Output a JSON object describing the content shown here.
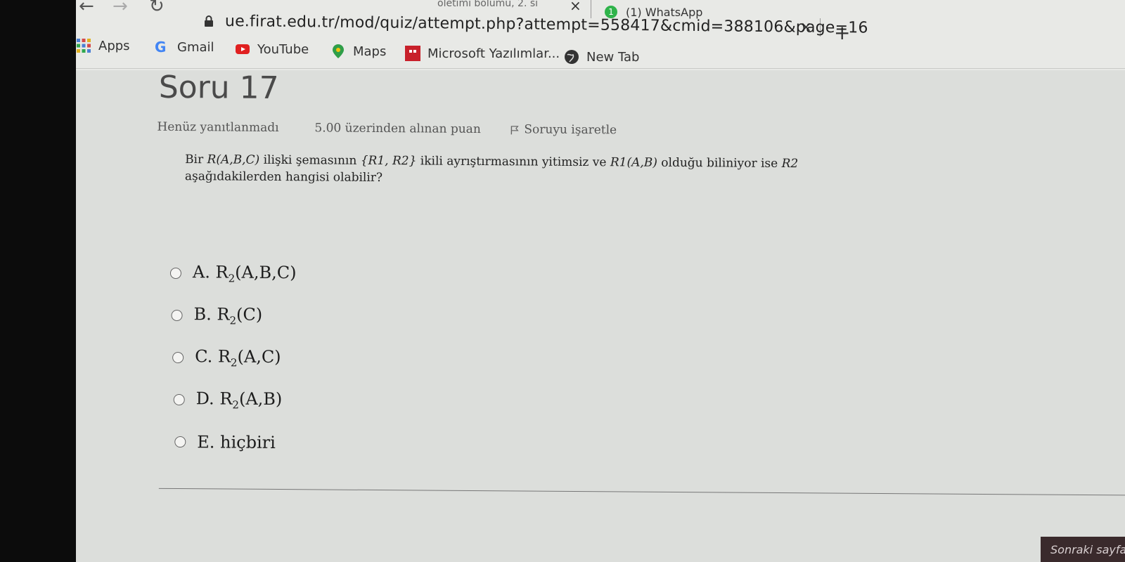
{
  "browser": {
    "tabs": [
      {
        "label": "öletimi bölümü, 2. sı",
        "close": "×"
      },
      {
        "label": "(1) WhatsApp",
        "badge": "1",
        "close": "×"
      }
    ],
    "new_tab": "+",
    "url": "ue.firat.edu.tr/mod/quiz/attempt.php?attempt=558417&cmid=388106&page=16",
    "bookmarks": [
      {
        "label": "Apps",
        "icon": "apps-grid-icon"
      },
      {
        "label": "Gmail",
        "icon": "google-g-icon"
      },
      {
        "label": "YouTube",
        "icon": "youtube-icon"
      },
      {
        "label": "Maps",
        "icon": "maps-pin-icon"
      },
      {
        "label": "Microsoft Yazılımlar...",
        "icon": "microsoft-icon"
      },
      {
        "label": "New Tab",
        "icon": "globe-icon"
      }
    ]
  },
  "quiz": {
    "title": "Soru 17",
    "status": "Henüz yanıtlanmadı",
    "grade": "5.00 üzerinden alınan puan",
    "flag": "Soruyu işaretle",
    "question_parts": {
      "p1": "Bir ",
      "rel": "R(A,B,C)",
      "p2": " ilişki şemasının ",
      "set": "{R1, R2}",
      "p3": " ikili ayrıştırmasının yitimsiz ve ",
      "r1": "R1(A,B)",
      "p4": " olduğu biliniyor ise ",
      "r2": "R2",
      "p5": " aşağıdakilerden hangisi olabilir?"
    },
    "options": [
      {
        "letter": "A.",
        "rel": "R",
        "sub": "2",
        "args": "(A,B,C)"
      },
      {
        "letter": "B.",
        "rel": "R",
        "sub": "2",
        "args": "(C)"
      },
      {
        "letter": "C.",
        "rel": "R",
        "sub": "2",
        "args": "(A,C)"
      },
      {
        "letter": "D.",
        "rel": "R",
        "sub": "2",
        "args": "(A,B)"
      },
      {
        "letter": "E.",
        "text": "hiçbiri"
      }
    ],
    "next_button": "Sonraki sayfa"
  },
  "colors": {
    "accent": "#3a2a2c",
    "page_bg": "#dcdedb"
  }
}
